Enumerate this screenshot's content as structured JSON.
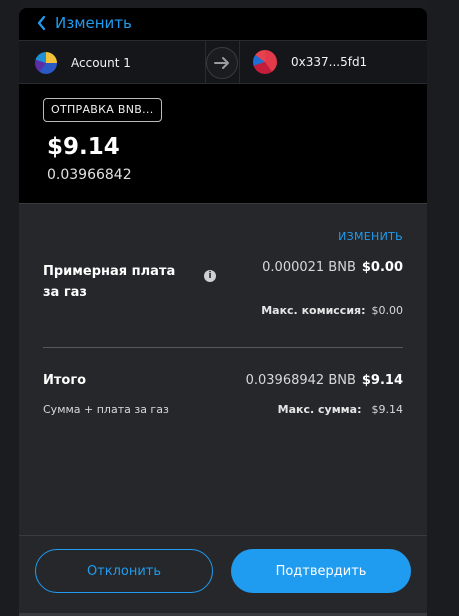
{
  "header": {
    "back_label": "Изменить"
  },
  "accounts": {
    "from_name": "Account 1",
    "to_address": "0x337...5fd1"
  },
  "transaction": {
    "type_badge": "ОТПРАВКА BNB...",
    "amount_usd": "$9.14",
    "amount_native": "0.03966842"
  },
  "details": {
    "edit_label": "ИЗМЕНИТЬ",
    "gas_label": "Примерная плата за газ",
    "gas_native": "0.000021 BNB",
    "gas_fiat": "$0.00",
    "max_fee_label": "Макс. комиссия:",
    "max_fee_value": "$0.00",
    "total_label": "Итого",
    "total_native": "0.03968942 BNB",
    "total_fiat": "$9.14",
    "total_sub_label": "Сумма + плата за газ",
    "max_amount_label": "Макс. сумма:",
    "max_amount_value": "$9.14"
  },
  "footer": {
    "reject_label": "Отклонить",
    "confirm_label": "Подтвердить"
  },
  "colors": {
    "accent": "#1f9cf0",
    "background": "#000000",
    "details_bg": "#25272b"
  },
  "icons": [
    "chevron-left-icon",
    "account-avatar-icon",
    "arrow-right-icon",
    "recipient-avatar-icon",
    "info-icon"
  ]
}
